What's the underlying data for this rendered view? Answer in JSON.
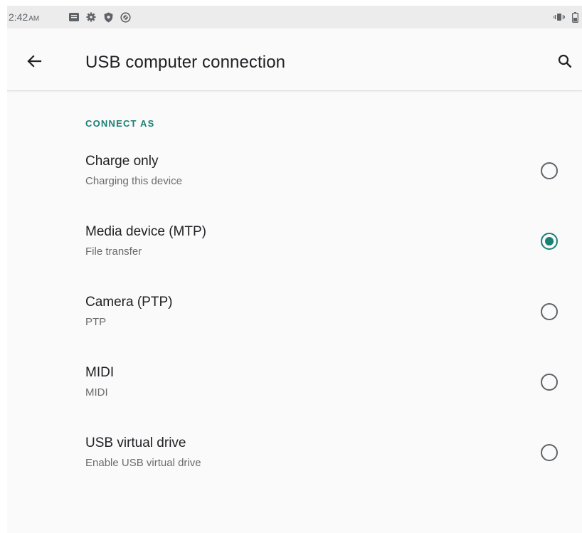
{
  "colors": {
    "accent": "#1a7f75",
    "status_bar": "#ececec",
    "background": "#fafafa"
  },
  "status_bar": {
    "time": "2:42",
    "ampm": "AM",
    "left_icons": [
      "message-icon",
      "settings-gear-icon",
      "shield-icon",
      "vpn-icon"
    ],
    "right_icons": [
      "vibrate-icon",
      "battery-icon"
    ]
  },
  "toolbar": {
    "back_icon": "arrow-back-icon",
    "title": "USB computer connection",
    "search_icon": "search-icon"
  },
  "section": {
    "header": "CONNECT AS"
  },
  "options": [
    {
      "title": "Charge only",
      "summary": "Charging this device",
      "selected": false
    },
    {
      "title": "Media device (MTP)",
      "summary": "File transfer",
      "selected": true
    },
    {
      "title": "Camera (PTP)",
      "summary": "PTP",
      "selected": false
    },
    {
      "title": "MIDI",
      "summary": "MIDI",
      "selected": false
    },
    {
      "title": "USB virtual drive",
      "summary": "Enable USB virtual drive",
      "selected": false
    }
  ]
}
